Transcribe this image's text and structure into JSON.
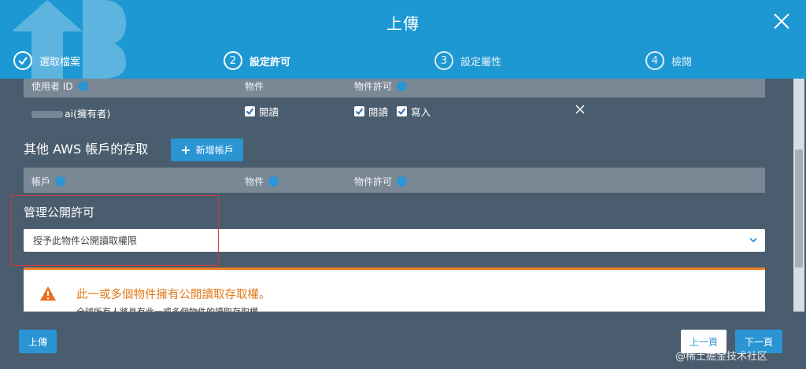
{
  "header": {
    "title": "上傳",
    "steps": [
      {
        "number": "",
        "label": "選取檔案",
        "state": "done"
      },
      {
        "number": "2",
        "label": "設定許可",
        "state": "active"
      },
      {
        "number": "3",
        "label": "設定屬性",
        "state": "inactive"
      },
      {
        "number": "4",
        "label": "檢閱",
        "state": "inactive"
      }
    ]
  },
  "owner_table": {
    "col_user_id": "使用者 ID",
    "col_objects": "物件",
    "col_object_permissions": "物件許可",
    "row": {
      "user_suffix": "ai(擁有者)",
      "objects_read": "閱讀",
      "perm_read": "閱讀",
      "perm_write": "寫入"
    }
  },
  "other_accounts": {
    "title": "其他 AWS 帳戶的存取",
    "add_button": "新增帳戶",
    "col_account": "帳戶",
    "col_objects": "物件",
    "col_object_permissions": "物件許可"
  },
  "public_permissions": {
    "title": "管理公開許可",
    "select_value": "授予此物件公開讀取權限"
  },
  "alert": {
    "title": "此一或多個物件擁有公開讀取存取權。",
    "subtitle": "全球所有人將具有此一或多個物件的讀取存取權。"
  },
  "footer": {
    "upload_button": "上傳",
    "prev_button": "上一頁",
    "next_button": "下一頁",
    "watermark": "@稀土掘金技术社区"
  },
  "colors": {
    "header_bg": "#1d98d3",
    "content_bg": "#4a5d6e",
    "accent": "#2b95d4",
    "warning": "#ee7d22"
  }
}
